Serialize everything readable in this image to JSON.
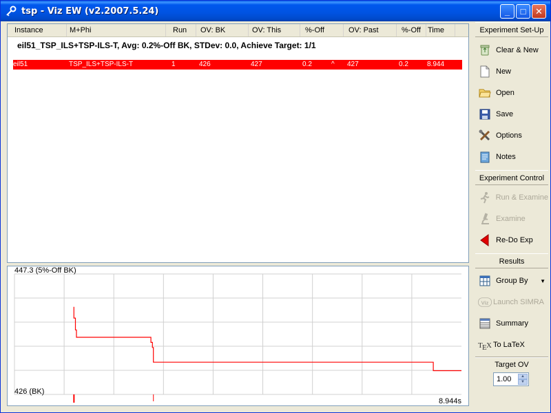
{
  "window": {
    "title": "tsp - Viz EW (v2.2007.5.24)"
  },
  "table": {
    "columns": [
      "Instance",
      "M+Phi",
      "Run",
      "OV: BK",
      "OV: This",
      "%-Off",
      "OV: Past",
      "%-Off",
      "Time"
    ],
    "group_summary": "eil51_TSP_ILS+TSP-ILS-T, Avg: 0.2%-Off BK, STDev: 0.0, Achieve Target: 1/1",
    "rows": [
      {
        "instance": "eil51",
        "mphi": "TSP_ILS+TSP-ILS-T",
        "run": "1",
        "ov_bk": "426",
        "ov_this": "427",
        "pct_off": "0.2",
        "marker": "^",
        "ov_past": "427",
        "pct_off_past": "0.2",
        "time": "8.944"
      }
    ]
  },
  "chart": {
    "top_label": "447.3 (5%-Off BK)",
    "bottom_label": "426 (BK)",
    "time_label": "8.944s",
    "line_color": "#FF0000"
  },
  "chart_data": {
    "type": "line",
    "title": "",
    "xlabel": "",
    "ylabel": "",
    "ylim": [
      426,
      447.3
    ],
    "xlim": [
      0,
      8.944
    ],
    "grid": true,
    "series": [
      {
        "x": [
          1.19,
          1.19,
          1.22,
          1.22,
          1.24,
          1.24,
          2.73,
          2.73,
          2.76,
          2.76,
          2.78,
          2.78,
          8.38,
          8.38,
          8.944
        ],
        "y": [
          441.5,
          439.5,
          439.5,
          437.4,
          437.4,
          436.1,
          436.1,
          435.2,
          435.2,
          434.3,
          434.3,
          431.7,
          431.7,
          430.2,
          430.2
        ]
      }
    ],
    "restart_marks_x": [
      1.19,
      2.78
    ]
  },
  "sidebar": {
    "setup_title": "Experiment Set-Up",
    "clear_new": "Clear & New",
    "new": "New",
    "open": "Open",
    "save": "Save",
    "options": "Options",
    "notes": "Notes",
    "control_title": "Experiment Control",
    "run_examine": "Run & Examine",
    "examine": "Examine",
    "redo": "Re-Do Exp",
    "results_title": "Results",
    "group_by": "Group By",
    "launch_simra": "Launch SIMRA",
    "summary": "Summary",
    "to_latex": "To LaTeX",
    "target_label": "Target OV",
    "target_value": "1.00"
  },
  "colors": {
    "title_bar": "#0054E3",
    "row_highlight": "#FF0000",
    "panel_bg": "#ECE9D8"
  }
}
